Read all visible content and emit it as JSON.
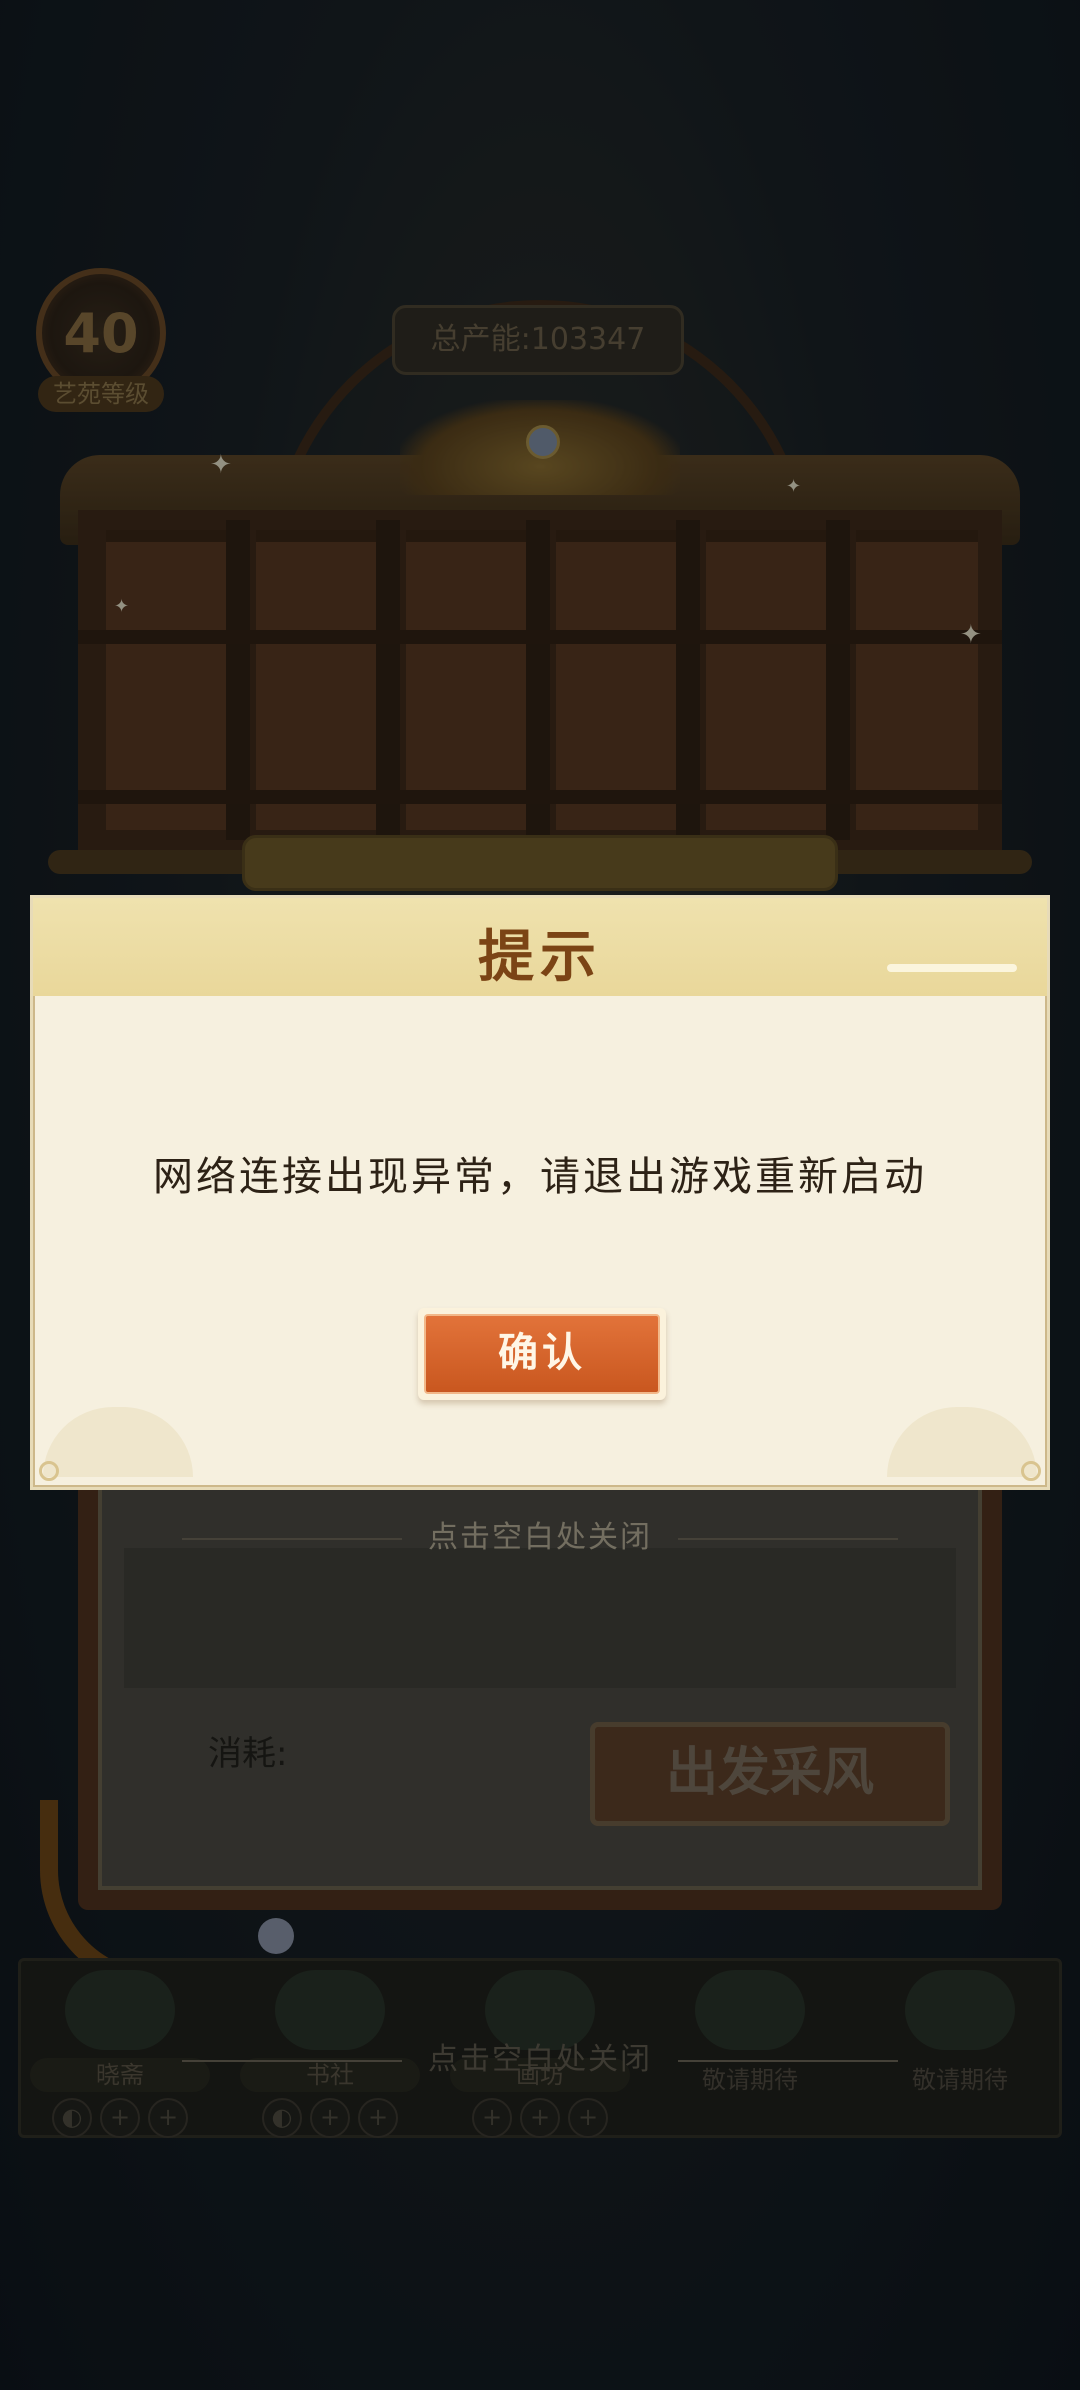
{
  "hud": {
    "level_value": "40",
    "level_label": "艺苑等级",
    "total_power": "总产能:103347"
  },
  "background_panel": {
    "close_hint": "点击空白处关闭",
    "consume_label": "消耗:",
    "depart_label": "出发采风"
  },
  "bottom_close_hint": "点击空白处关闭",
  "shop_items": [
    {
      "name": "晓斋",
      "icon": "green-figure-icon"
    },
    {
      "name": "书社",
      "icon": "white-bird-icon"
    },
    {
      "name": "画坊",
      "icon": "panda-icon"
    },
    {
      "name": "",
      "status": "敬请期待",
      "icon": "rooster-icon"
    },
    {
      "name": "",
      "status": "敬请期待",
      "icon": "peacock-icon"
    }
  ],
  "dialog": {
    "title": "提示",
    "message": "网络连接出现异常，请退出游戏重新启动",
    "confirm_label": "确认"
  },
  "colors": {
    "dialog_bg": "#f6f0df",
    "title_color": "#7b4415",
    "confirm_button": "#d7642b"
  }
}
